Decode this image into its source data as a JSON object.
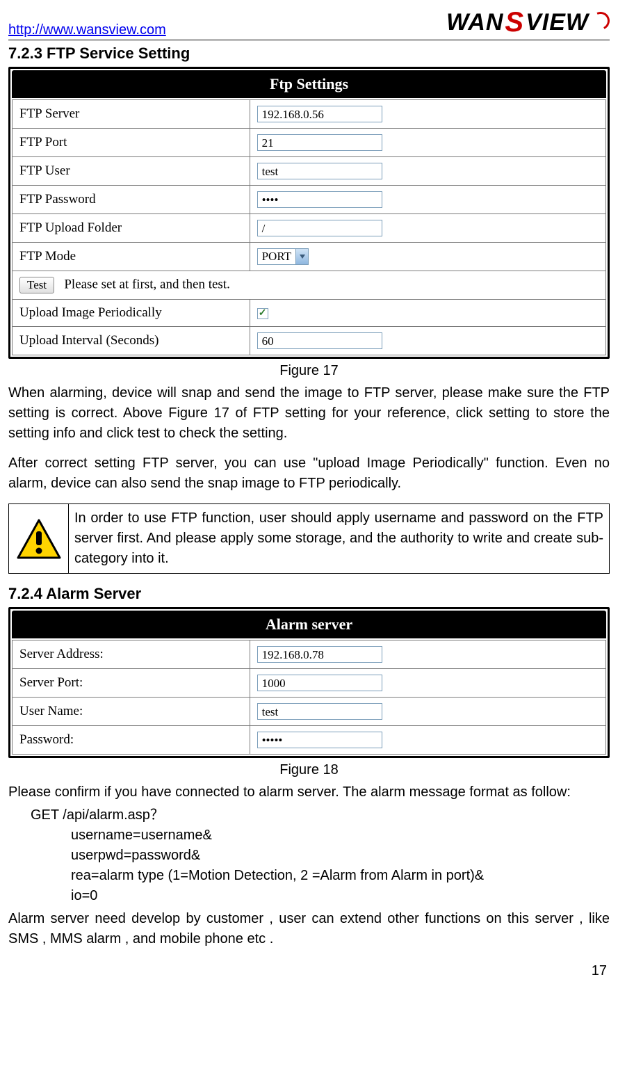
{
  "header": {
    "url": "http://www.wansview.com",
    "logo_wan": "WAN",
    "logo_view": "VIEW"
  },
  "section723": {
    "heading": "7.2.3   FTP Service Setting",
    "panel_title": "Ftp  Settings",
    "rows": {
      "server_label": "FTP Server",
      "server_value": "192.168.0.56",
      "port_label": "FTP Port",
      "port_value": "21",
      "user_label": "FTP User",
      "user_value": "test",
      "pass_label": "FTP Password",
      "pass_value": "••••",
      "folder_label": "FTP Upload Folder",
      "folder_value": "/",
      "mode_label": "FTP Mode",
      "mode_value": "PORT",
      "test_button": "Test",
      "test_hint": "Please set at first, and then test.",
      "periodic_label": "Upload Image Periodically",
      "periodic_checked": "✓",
      "interval_label": "Upload Interval (Seconds)",
      "interval_value": "60"
    },
    "figure_caption": "Figure 17",
    "paragraph1": "When alarming, device will snap and send the image to FTP server, please make sure the FTP setting is correct. Above Figure 17 of FTP setting for your reference, click setting to store the setting info and click test to check the setting.",
    "paragraph2": "After correct setting FTP server, you can use \"upload Image Periodically\" function. Even no alarm, device can also send the snap image to FTP periodically.",
    "note": "In order to use FTP function, user should apply username and password on the FTP server first. And please apply some storage, and the authority to write and create sub-category into it."
  },
  "section724": {
    "heading": "7.2.4   Alarm Server",
    "panel_title": "Alarm server",
    "rows": {
      "addr_label": "Server Address:",
      "addr_value": "192.168.0.78",
      "port_label": "Server Port:",
      "port_value": "1000",
      "user_label": "User Name:",
      "user_value": "test",
      "pass_label": "Password:",
      "pass_value": "•••••"
    },
    "figure_caption": "Figure 18",
    "paragraph1": "Please confirm if you have connected to alarm server. The alarm message format as follow:",
    "line_get": "GET /api/alarm.asp？",
    "line_username": "username=username&",
    "line_userpwd": "userpwd=password&",
    "line_rea": "rea=alarm type (1=Motion Detection, 2 =Alarm from Alarm in port)&",
    "line_io": "io=0",
    "paragraph2": "Alarm server need develop by customer , user can extend other functions on this server , like SMS , MMS alarm , and mobile phone etc ."
  },
  "page_number": "17"
}
